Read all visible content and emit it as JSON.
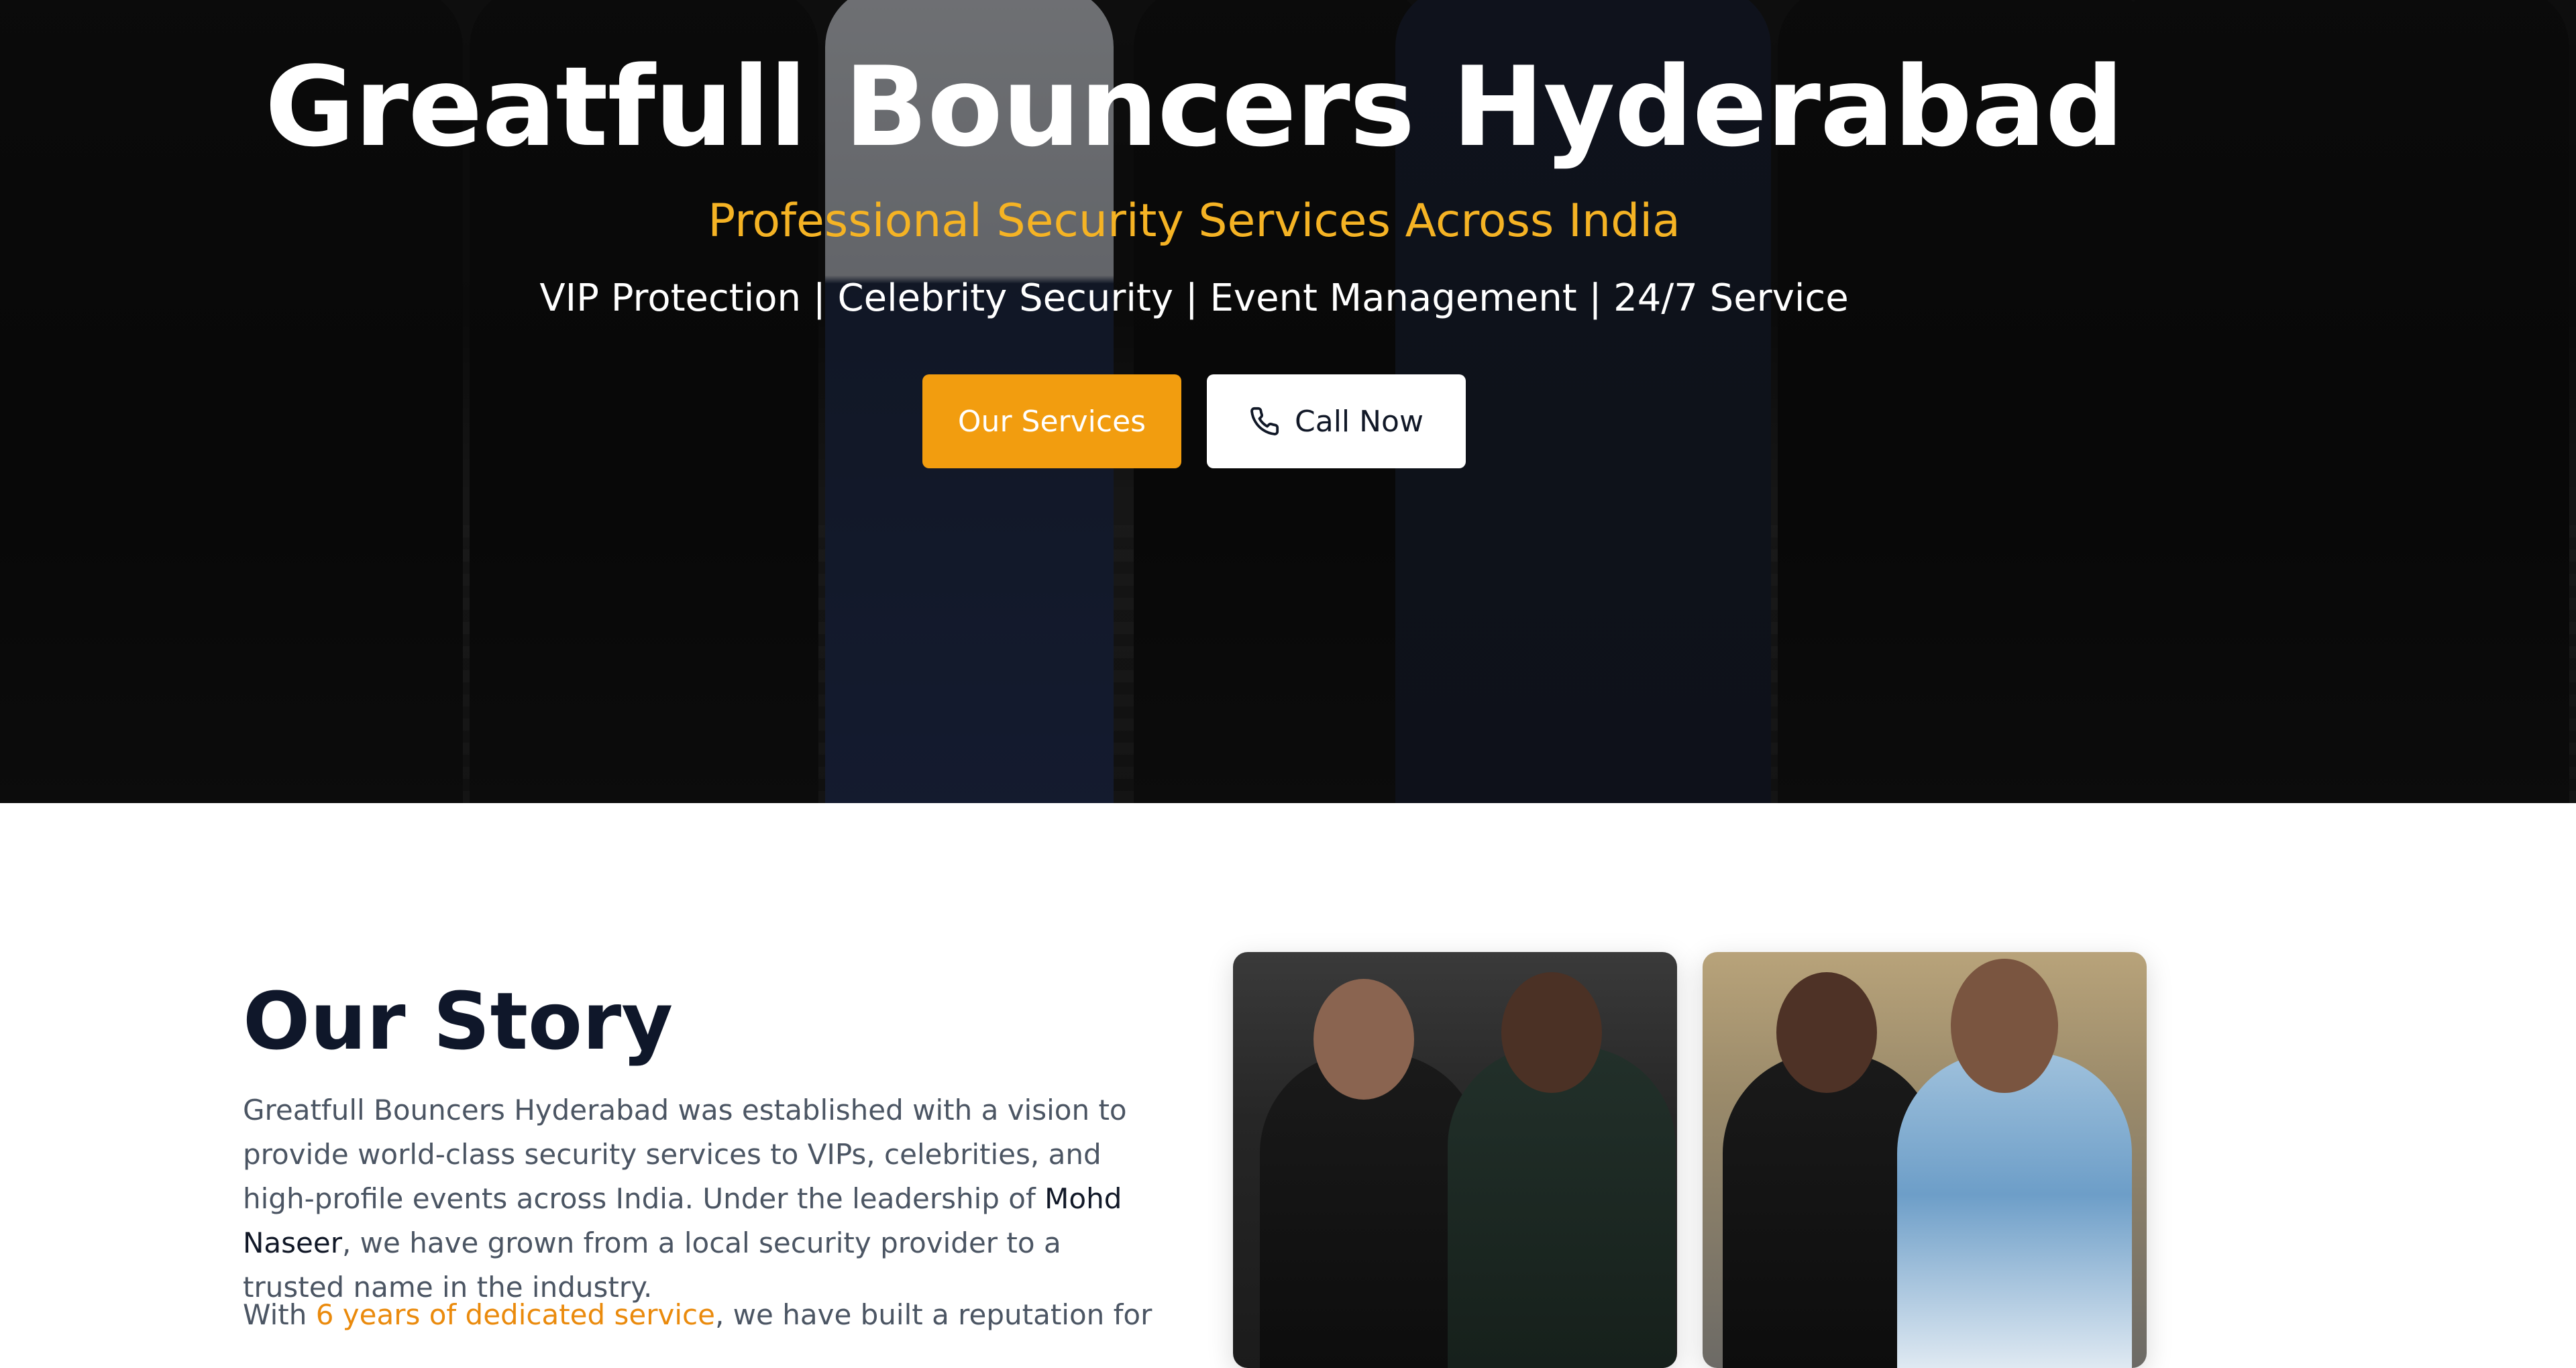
{
  "hero": {
    "title": "Greatfull Bouncers Hyderabad",
    "subtitle": "Professional Security Services Across India",
    "tagline": "VIP Protection | Celebrity Security | Event Management | 24/7 Service",
    "buttons": {
      "services_label": "Our Services",
      "call_label": "Call Now",
      "call_icon": "phone-icon"
    }
  },
  "story": {
    "title": "Our Story",
    "p1_before": "Greatfull Bouncers Hyderabad was established with a vision to provide world-class security services to VIPs, celebrities, and high-profile events across India. Under the leadership of ",
    "p1_highlight": "Mohd Naseer",
    "p1_after": ", we have grown from a local security provider to a trusted name in the industry.",
    "p2_before": "With ",
    "p2_highlight": "6 years of dedicated service",
    "p2_after": ", we have built a reputation for"
  },
  "colors": {
    "accent": "#f29d0f",
    "subtitle": "#f5b324",
    "heading": "#0f172a",
    "body_text": "#4b5563"
  }
}
